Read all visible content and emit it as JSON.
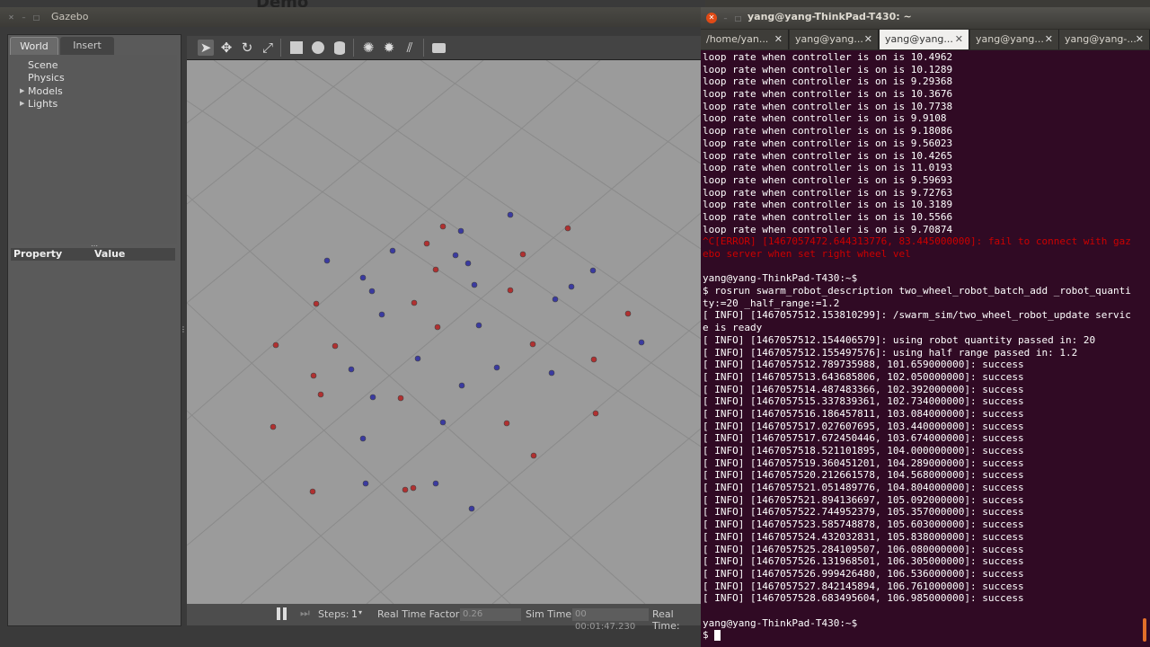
{
  "gazebo": {
    "window_title": "Gazebo",
    "background_text": "Demo",
    "tabs": [
      "World",
      "Insert"
    ],
    "tree_items": [
      "Scene",
      "Physics",
      "Models",
      "Lights"
    ],
    "property_header": {
      "property": "Property",
      "value": "Value"
    },
    "toolbar_icons": [
      "select-arrow-icon",
      "translate-icon",
      "rotate-icon",
      "scale-icon",
      "box-icon",
      "sphere-icon",
      "cylinder-icon",
      "point-light-icon",
      "spot-light-icon",
      "directional-light-icon",
      "screenshot-icon"
    ],
    "status": {
      "steps_label": "Steps:",
      "steps_value": "1",
      "rtf_label": "Real Time Factor:",
      "rtf_value": "0.26",
      "sim_time_label": "Sim Time:",
      "sim_time_value": "00 00:01:47.230",
      "real_time_label": "Real Time:"
    },
    "colors": {
      "scene_bg": "#9b9b9b",
      "robot_red": "#b03030",
      "robot_blue": "#3a3aa0"
    }
  },
  "terminal": {
    "window_title": "yang@yang-ThinkPad-T430: ~",
    "tabs": [
      "/home/yan...",
      "yang@yang...",
      "yang@yang...",
      "yang@yang...",
      "yang@yang-..."
    ],
    "active_tab": 2,
    "lines": [
      "loop rate when controller is on is 10.4962",
      "loop rate when controller is on is 10.1289",
      "loop rate when controller is on is 9.29368",
      "loop rate when controller is on is 10.3676",
      "loop rate when controller is on is 10.7738",
      "loop rate when controller is on is 9.9108",
      "loop rate when controller is on is 9.18086",
      "loop rate when controller is on is 9.56023",
      "loop rate when controller is on is 10.4265",
      "loop rate when controller is on is 11.0193",
      "loop rate when controller is on is 9.59693",
      "loop rate when controller is on is 9.72763",
      "loop rate when controller is on is 10.3189",
      "loop rate when controller is on is 10.5566",
      "loop rate when controller is on is 9.70874",
      "^C[ERROR] [1467057472.644313776, 83.445000000]: fail to connect with gaz",
      "ebo server when set right wheel vel",
      "",
      "yang@yang-ThinkPad-T430:~$",
      "$ rosrun swarm_robot_description two_wheel_robot_batch_add _robot_quanti",
      "ty:=20 _half_range:=1.2",
      "[ INFO] [1467057512.153810299]: /swarm_sim/two_wheel_robot_update servic",
      "e is ready",
      "[ INFO] [1467057512.154406579]: using robot quantity passed in: 20",
      "[ INFO] [1467057512.155497576]: using half range passed in: 1.2",
      "[ INFO] [1467057512.789735988, 101.659000000]: success",
      "[ INFO] [1467057513.643685806, 102.050000000]: success",
      "[ INFO] [1467057514.487483366, 102.392000000]: success",
      "[ INFO] [1467057515.337839361, 102.734000000]: success",
      "[ INFO] [1467057516.186457811, 103.084000000]: success",
      "[ INFO] [1467057517.027607695, 103.440000000]: success",
      "[ INFO] [1467057517.672450446, 103.674000000]: success",
      "[ INFO] [1467057518.521101895, 104.000000000]: success",
      "[ INFO] [1467057519.360451201, 104.289000000]: success",
      "[ INFO] [1467057520.212661578, 104.568000000]: success",
      "[ INFO] [1467057521.051489776, 104.804000000]: success",
      "[ INFO] [1467057521.894136697, 105.092000000]: success",
      "[ INFO] [1467057522.744952379, 105.357000000]: success",
      "[ INFO] [1467057523.585748878, 105.603000000]: success",
      "[ INFO] [1467057524.432032831, 105.838000000]: success",
      "[ INFO] [1467057525.284109507, 106.080000000]: success",
      "[ INFO] [1467057526.131968501, 106.305000000]: success",
      "[ INFO] [1467057526.999426480, 106.536000000]: success",
      "[ INFO] [1467057527.842145894, 106.761000000]: success",
      "[ INFO] [1467057528.683495604, 106.985000000]: success",
      "",
      "yang@yang-ThinkPad-T430:~$",
      "$ "
    ],
    "error_lines": [
      15,
      16
    ],
    "colors": {
      "bg": "#300a24",
      "text": "#ffffff",
      "error": "#cc0000"
    }
  }
}
